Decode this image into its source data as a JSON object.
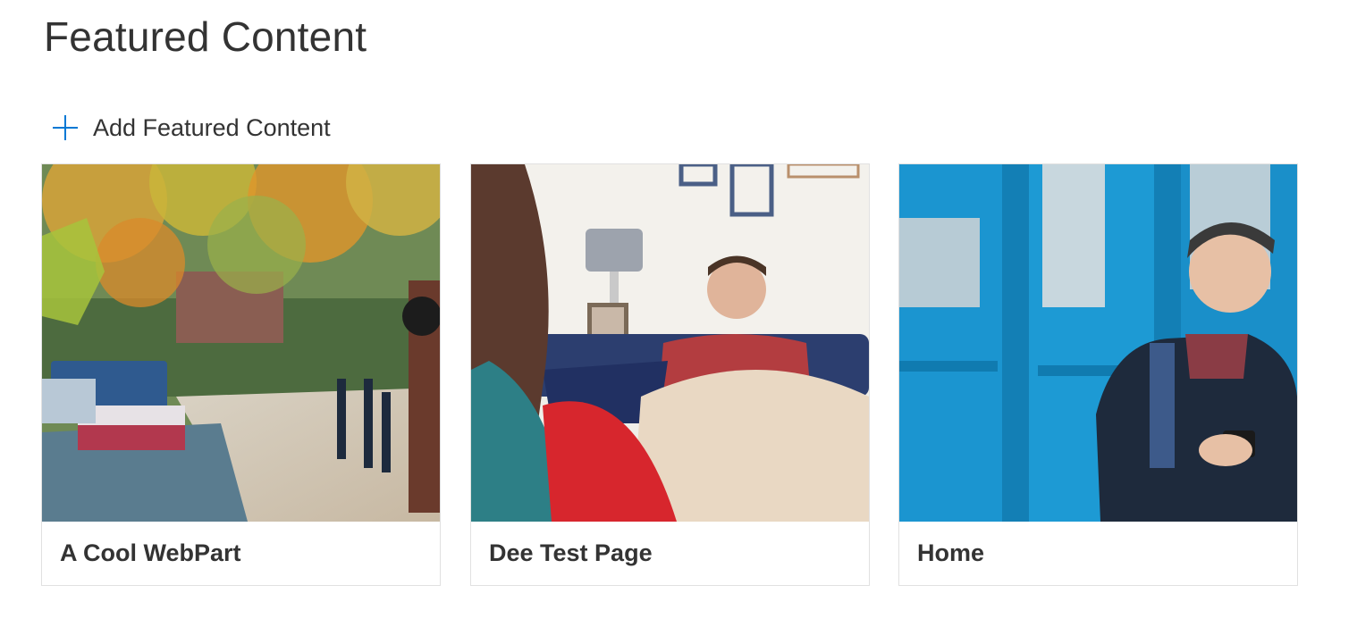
{
  "page": {
    "title": "Featured Content"
  },
  "toolbar": {
    "add_label": "Add Featured Content",
    "add_icon": "plus-icon",
    "accent_color": "#0078d4"
  },
  "cards": [
    {
      "title": "A Cool WebPart",
      "image": "autumn-canal-photographer-photo"
    },
    {
      "title": "Dee Test Page",
      "image": "man-on-sofa-living-room-photo"
    },
    {
      "title": "Home",
      "image": "man-with-phone-blue-door-photo"
    }
  ]
}
